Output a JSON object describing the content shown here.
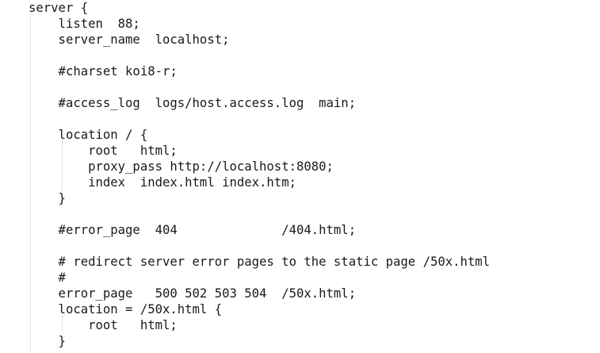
{
  "code": {
    "lines": [
      "server {",
      "    listen  88;",
      "    server_name  localhost;",
      "",
      "    #charset koi8-r;",
      "",
      "    #access_log  logs/host.access.log  main;",
      "",
      "    location / {",
      "        root   html;",
      "        proxy_pass http://localhost:8080;",
      "        index  index.html index.htm;",
      "    }",
      "",
      "    #error_page  404              /404.html;",
      "",
      "    # redirect server error pages to the static page /50x.html",
      "    #",
      "    error_page   500 502 503 504  /50x.html;",
      "    location = /50x.html {",
      "        root   html;",
      "    }"
    ]
  }
}
